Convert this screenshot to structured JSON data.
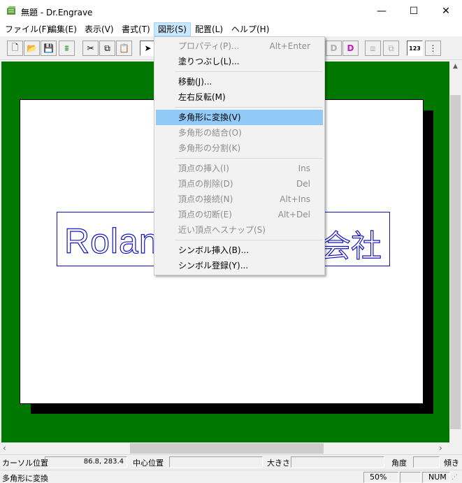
{
  "window": {
    "title": "無題 - Dr.Engrave",
    "minimize": "—",
    "maximize": "☐",
    "close": "✕"
  },
  "menubar": [
    {
      "label": "ファイル(F)"
    },
    {
      "label": "編集(E)"
    },
    {
      "label": "表示(V)"
    },
    {
      "label": "書式(T)"
    },
    {
      "label": "図形(S)"
    },
    {
      "label": "配置(L)"
    },
    {
      "label": "ヘルプ(H)"
    }
  ],
  "toolbar": {
    "buttons": [
      {
        "icon": "new-file-icon",
        "glyph": "🗋"
      },
      {
        "icon": "open-folder-icon",
        "glyph": "📂"
      },
      {
        "icon": "save-icon",
        "glyph": "💾"
      },
      {
        "icon": "scan-icon",
        "glyph": "⩩"
      },
      {
        "icon": "cut-icon",
        "glyph": "✂"
      },
      {
        "icon": "copy-icon",
        "glyph": "⧉"
      },
      {
        "icon": "paste-icon",
        "glyph": "📋"
      },
      {
        "icon": "select-arrow-icon",
        "glyph": "➤"
      },
      {
        "icon": "letter-d-icon",
        "glyph": "D"
      },
      {
        "icon": "letter-d-outline-icon",
        "glyph": "D"
      },
      {
        "icon": "group-icon",
        "glyph": "⧈"
      },
      {
        "icon": "ungroup-icon",
        "glyph": "⧉"
      },
      {
        "icon": "number-icon",
        "glyph": "123"
      },
      {
        "icon": "vertical-number-icon",
        "glyph": "⋮"
      }
    ]
  },
  "canvas": {
    "text_left": "Rolan",
    "text_right": "会社"
  },
  "shape_menu": {
    "items": [
      {
        "label": "プロパティ(P)...",
        "shortcut": "Alt+Enter",
        "disabled": true
      },
      {
        "label": "塗りつぶし(L)...",
        "shortcut": "",
        "disabled": false
      },
      {
        "label": "移動(J)...",
        "shortcut": "",
        "disabled": false
      },
      {
        "label": "左右反転(M)",
        "shortcut": "",
        "disabled": false
      },
      {
        "label": "多角形に変換(V)",
        "shortcut": "",
        "disabled": false,
        "highlighted": true
      },
      {
        "label": "多角形の結合(O)",
        "shortcut": "",
        "disabled": true
      },
      {
        "label": "多角形の分割(K)",
        "shortcut": "",
        "disabled": true
      },
      {
        "label": "頂点の挿入(I)",
        "shortcut": "Ins",
        "disabled": true
      },
      {
        "label": "頂点の削除(D)",
        "shortcut": "Del",
        "disabled": true
      },
      {
        "label": "頂点の接続(N)",
        "shortcut": "Alt+Ins",
        "disabled": true
      },
      {
        "label": "頂点の切断(E)",
        "shortcut": "Alt+Del",
        "disabled": true
      },
      {
        "label": "近い頂点へスナップ(S)",
        "shortcut": "",
        "disabled": true
      },
      {
        "label": "シンボル挿入(B)...",
        "shortcut": "",
        "disabled": false
      },
      {
        "label": "シンボル登録(Y)...",
        "shortcut": "",
        "disabled": false
      }
    ]
  },
  "infobar": {
    "cursor_label": "カーソル位置",
    "cursor_value": "86.8, 283.4",
    "center_label": "中心位置",
    "center_value": "",
    "size_label": "大きさ",
    "size_value": "",
    "angle_label": "角度",
    "angle_value": "",
    "tilt_label": "傾き"
  },
  "statusbar": {
    "message": "多角形に変換",
    "zoom": "50%",
    "num": "NUM"
  },
  "colors": {
    "canvas_green": "#007800",
    "outline_blue": "#1010c0",
    "menu_highlight": "#91c9f7"
  }
}
